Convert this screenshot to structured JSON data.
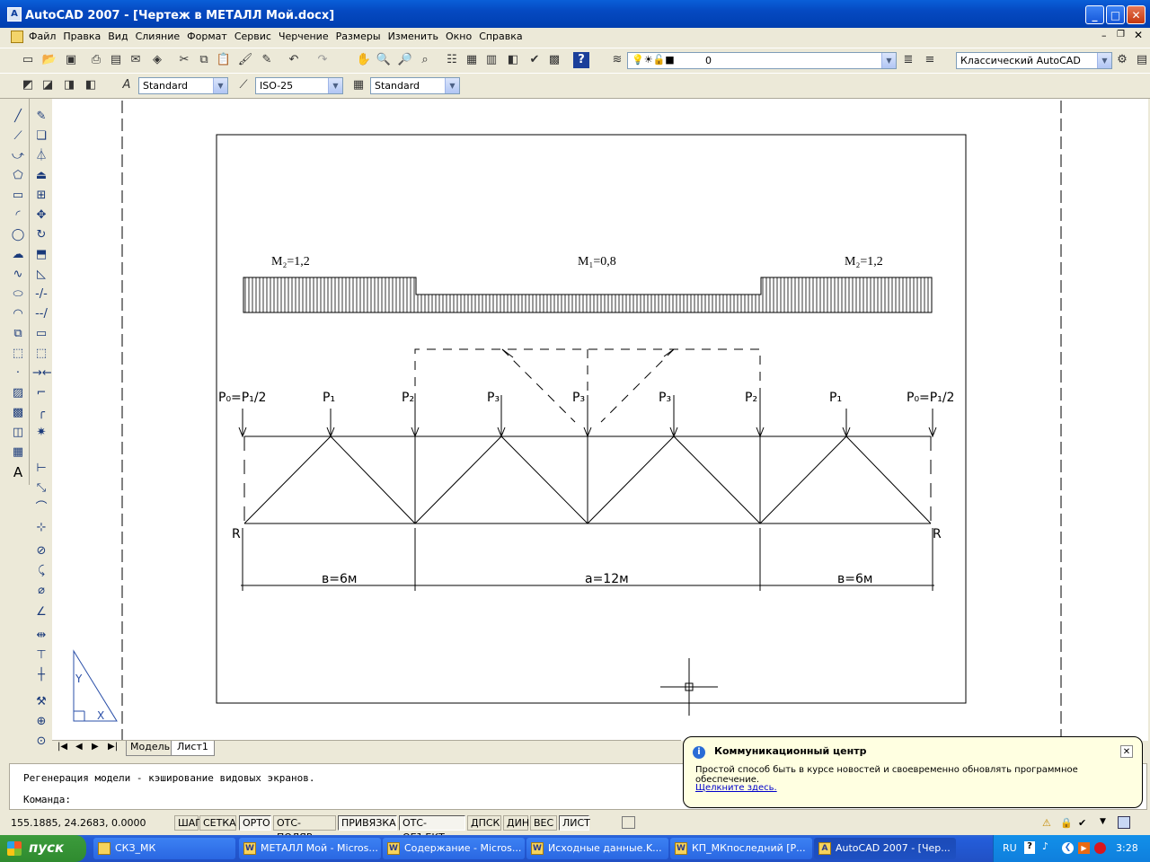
{
  "window": {
    "title": "AutoCAD 2007 - [Чертеж в МЕТАЛЛ Мой.docx]"
  },
  "menu": [
    "Файл",
    "Правка",
    "Вид",
    "Слияние",
    "Формат",
    "Сервис",
    "Черчение",
    "Размеры",
    "Изменить",
    "Окно",
    "Справка"
  ],
  "toolbar": {
    "layer_value": "0",
    "workspace": "Классический AutoCAD",
    "text_style": "Standard",
    "dim_style": "ISO-25",
    "table_style": "Standard"
  },
  "drawing": {
    "loads": {
      "m_left": "M₂=1,2",
      "m_mid": "M₁=0,8",
      "m_right": "M₂=1,2"
    },
    "forces": [
      "P₀=P₁/2",
      "P₁",
      "P₂",
      "P₃",
      "P₃",
      "P₃",
      "P₂",
      "P₁",
      "P₀=P₁/2"
    ],
    "reaction_left": "R",
    "reaction_right": "R",
    "dims": [
      "в=6м",
      "a=12м",
      "в=6м"
    ],
    "ucs_y": "Y",
    "ucs_x": "X"
  },
  "layout_tabs": {
    "model": "Модель",
    "sheet": "Лист1"
  },
  "command": {
    "history": "Регенерация модели - кэширование видовых экранов.",
    "prompt": "Команда:"
  },
  "status": {
    "coords": "155.1885, 24.2683, 0.0000",
    "toggles": [
      "ШАГ",
      "СЕТКА",
      "ОРТО",
      "ОТС-ПОЛЯР",
      "ПРИВЯЗКА",
      "ОТС-ОБЪЕКТ",
      "ДПСК",
      "ДИН",
      "ВЕС",
      "ЛИСТ"
    ]
  },
  "balloon": {
    "title": "Коммуникационный центр",
    "text": "Простой способ быть в курсе новостей и своевременно обновлять программное обеспечение.",
    "link": "Щелкните здесь."
  },
  "taskbar": {
    "start": "пуск",
    "tasks": [
      "СКЗ_МК",
      "МЕТАЛЛ Мой - Micros...",
      "Содержание - Micros...",
      "Исходные данные.K...",
      "КП_МКпоследний [Р...",
      "AutoCAD 2007 - [Чер..."
    ],
    "lang": "RU",
    "clock": "3:28"
  }
}
